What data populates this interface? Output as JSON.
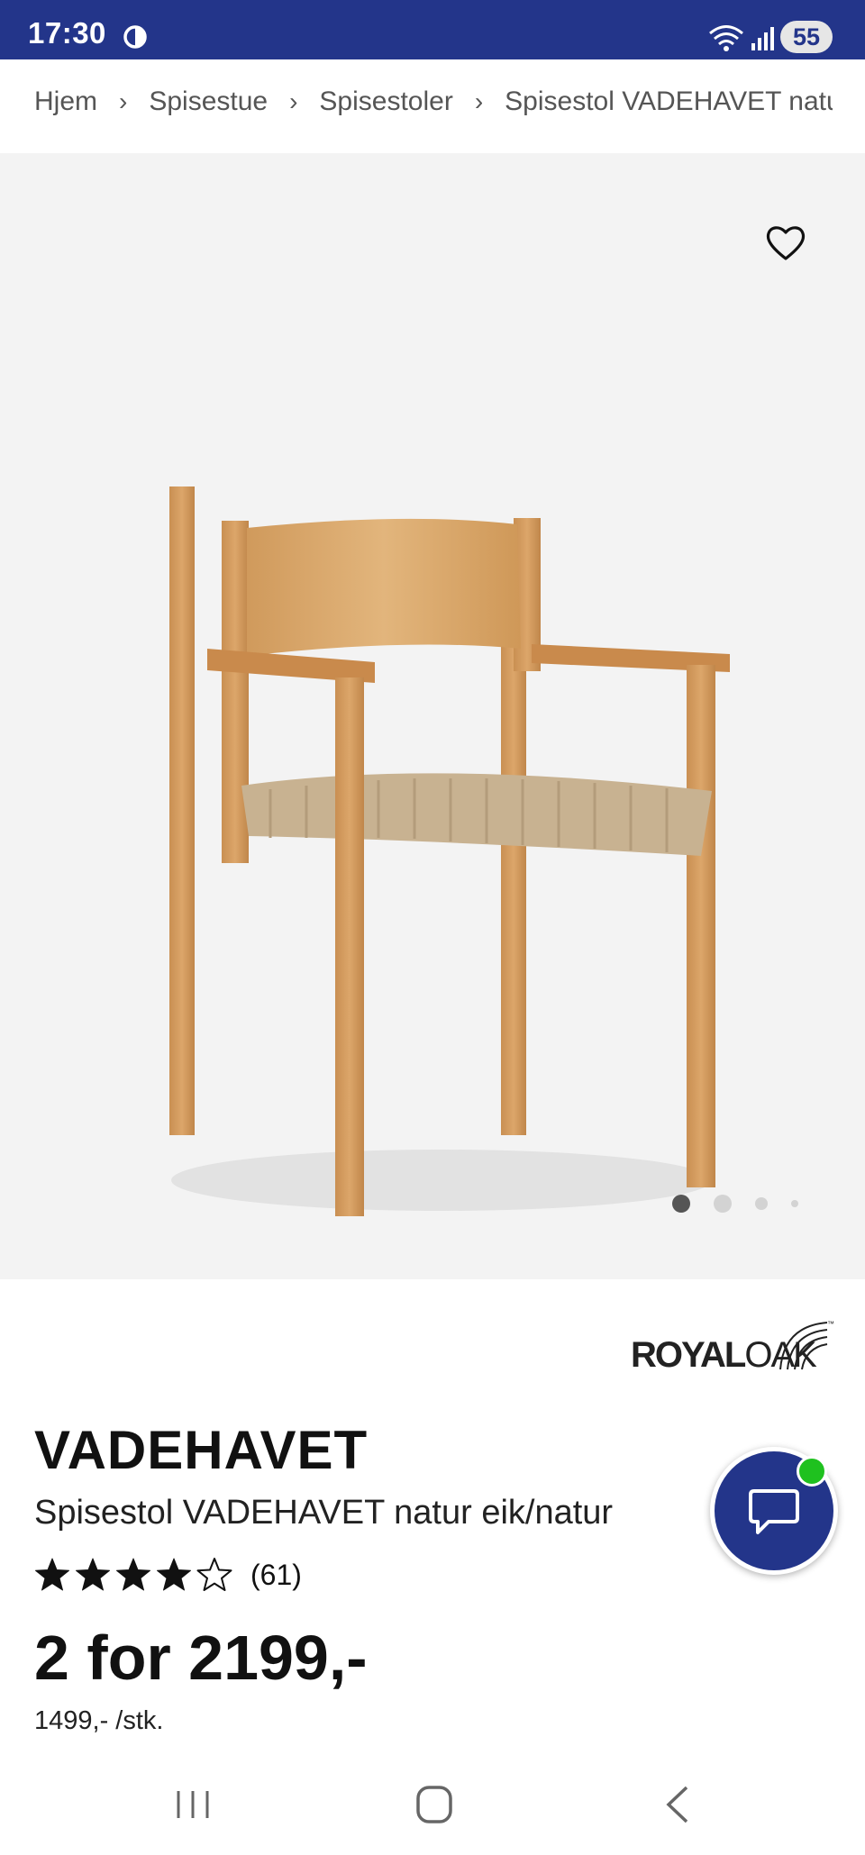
{
  "status_bar": {
    "time": "17:30",
    "battery": "55",
    "icons": [
      "sync-icon",
      "wifi-icon",
      "signal-icon",
      "battery-icon"
    ]
  },
  "breadcrumb": {
    "items": [
      "Hjem",
      "Spisestue",
      "Spisestoler"
    ],
    "current": "Spisestol VADEHAVET natur eik/natur",
    "separator": "›"
  },
  "gallery": {
    "image_count": 4,
    "active_index": 0,
    "favorite_icon": "heart-outline-icon"
  },
  "product": {
    "brand": {
      "bold": "ROYAL",
      "light": "OAK",
      "tm": "™"
    },
    "title": "VADEHAVET",
    "subtitle": "Spisestol VADEHAVET natur eik/natur",
    "rating": 4,
    "rating_max": 5,
    "review_count": "(61)",
    "price": "2 for 2199,-",
    "unit_price": "1499,- /stk."
  },
  "chat": {
    "icon": "chat-bubble-icon",
    "status": "online"
  },
  "nav": {
    "icons": [
      "recents-icon",
      "home-icon",
      "back-icon"
    ]
  },
  "colors": {
    "primary": "#23358a",
    "online": "#1fc11f",
    "image_bg": "#f3f3f3"
  }
}
